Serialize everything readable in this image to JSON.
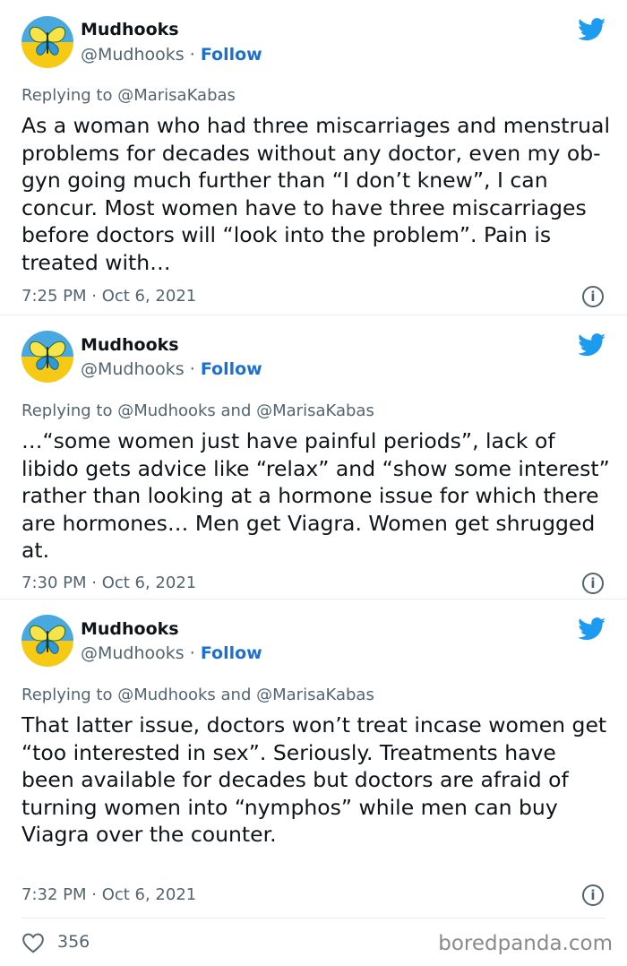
{
  "brand_colors": {
    "twitter_blue": "#1d9bf0",
    "follow_blue": "#1d6fd1",
    "muted": "#536471"
  },
  "tweets": [
    {
      "name": "Mudhooks",
      "handle": "@Mudhooks",
      "separator": "·",
      "follow_label": "Follow",
      "reply_to": "Replying to @MarisaKabas",
      "text": "As a woman who had three miscarriages and menstrual problems for decades without any doctor, even my ob-gyn going much further than “I don’t knew”, I can concur. Most women have to have three miscarriages before doctors will “look into the problem”. Pain is treated with…",
      "time": "7:25 PM · Oct 6, 2021",
      "icons": [
        "butterfly-avatar",
        "twitter-bird-icon",
        "info-icon"
      ]
    },
    {
      "name": "Mudhooks",
      "handle": "@Mudhooks",
      "separator": "·",
      "follow_label": "Follow",
      "reply_to": "Replying to @Mudhooks and @MarisaKabas",
      "text": "…“some women just have painful periods”, lack of libido gets advice like “relax” and “show some interest” rather than looking at a hormone issue for which there are hormones… Men get Viagra. Women get shrugged at.",
      "time": "7:30 PM · Oct 6, 2021",
      "icons": [
        "butterfly-avatar",
        "twitter-bird-icon",
        "info-icon"
      ]
    },
    {
      "name": "Mudhooks",
      "handle": "@Mudhooks",
      "separator": "·",
      "follow_label": "Follow",
      "reply_to": "Replying to @Mudhooks and @MarisaKabas",
      "text": "That latter issue, doctors won’t treat incase women get “too interested in sex”. Seriously. Treatments have been available for decades but doctors are afraid of turning women into “nymphos” while men can buy Viagra over the counter.",
      "time": "7:32 PM · Oct 6, 2021",
      "icons": [
        "butterfly-avatar",
        "twitter-bird-icon",
        "info-icon"
      ]
    }
  ],
  "likes": {
    "icon": "heart-icon",
    "count": "356"
  },
  "watermark": "boredpanda.com"
}
